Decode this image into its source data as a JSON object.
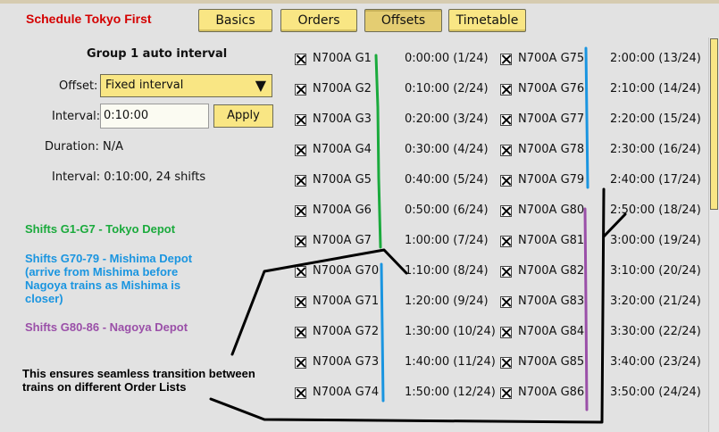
{
  "window": {
    "title": "Schedule Tokyo First"
  },
  "tabs": [
    {
      "label": "Basics"
    },
    {
      "label": "Orders"
    },
    {
      "label": "Offsets",
      "active": true
    },
    {
      "label": "Timetable"
    }
  ],
  "panel": {
    "heading": "Group 1 auto interval",
    "offset_label": "Offset:",
    "offset_value": "Fixed interval",
    "interval_label": "Interval:",
    "interval_value": "0:10:00",
    "apply_label": "Apply",
    "duration_text": "Duration: N/A",
    "interval_summary": "Interval: 0:10:00, 24 shifts"
  },
  "notes": {
    "tokyo": "Shifts G1-G7 - Tokyo Depot",
    "mishima_1": "Shifts G70-79 - Mishima Depot",
    "mishima_2": "(arrive from Mishima before",
    "mishima_3": "Nagoya trains as Mishima is",
    "mishima_4": "closer)",
    "nagoya": "Shifts G80-86 - Nagoya Depot",
    "transition_1": "This ensures seamless transition between",
    "transition_2": "trains on different Order Lists"
  },
  "colors": {
    "tokyo": "#1aaa3c",
    "mishima": "#1a95e0",
    "nagoya": "#9a4fa8",
    "title": "#d40000"
  },
  "left_column": [
    {
      "train": "N700A G1",
      "offset": "0:00:00 (1/24)",
      "checked": true
    },
    {
      "train": "N700A G2",
      "offset": "0:10:00 (2/24)",
      "checked": true
    },
    {
      "train": "N700A G3",
      "offset": "0:20:00 (3/24)",
      "checked": true
    },
    {
      "train": "N700A G4",
      "offset": "0:30:00 (4/24)",
      "checked": true
    },
    {
      "train": "N700A G5",
      "offset": "0:40:00 (5/24)",
      "checked": true
    },
    {
      "train": "N700A G6",
      "offset": "0:50:00 (6/24)",
      "checked": true
    },
    {
      "train": "N700A G7",
      "offset": "1:00:00 (7/24)",
      "checked": true
    },
    {
      "train": "N700A G70",
      "offset": "1:10:00 (8/24)",
      "checked": true
    },
    {
      "train": "N700A G71",
      "offset": "1:20:00 (9/24)",
      "checked": true
    },
    {
      "train": "N700A G72",
      "offset": "1:30:00 (10/24)",
      "checked": true
    },
    {
      "train": "N700A G73",
      "offset": "1:40:00 (11/24)",
      "checked": true
    },
    {
      "train": "N700A G74",
      "offset": "1:50:00 (12/24)",
      "checked": true
    }
  ],
  "right_column": [
    {
      "train": "N700A G75",
      "offset": "2:00:00 (13/24)",
      "checked": true
    },
    {
      "train": "N700A G76",
      "offset": "2:10:00 (14/24)",
      "checked": true
    },
    {
      "train": "N700A G77",
      "offset": "2:20:00 (15/24)",
      "checked": true
    },
    {
      "train": "N700A G78",
      "offset": "2:30:00 (16/24)",
      "checked": true
    },
    {
      "train": "N700A G79",
      "offset": "2:40:00 (17/24)",
      "checked": true
    },
    {
      "train": "N700A G80",
      "offset": "2:50:00 (18/24)",
      "checked": true
    },
    {
      "train": "N700A G81",
      "offset": "3:00:00 (19/24)",
      "checked": true
    },
    {
      "train": "N700A G82",
      "offset": "3:10:00 (20/24)",
      "checked": true
    },
    {
      "train": "N700A G83",
      "offset": "3:20:00 (21/24)",
      "checked": true
    },
    {
      "train": "N700A G84",
      "offset": "3:30:00 (22/24)",
      "checked": true
    },
    {
      "train": "N700A G85",
      "offset": "3:40:00 (23/24)",
      "checked": true
    },
    {
      "train": "N700A G86",
      "offset": "3:50:00 (24/24)",
      "checked": true
    }
  ]
}
